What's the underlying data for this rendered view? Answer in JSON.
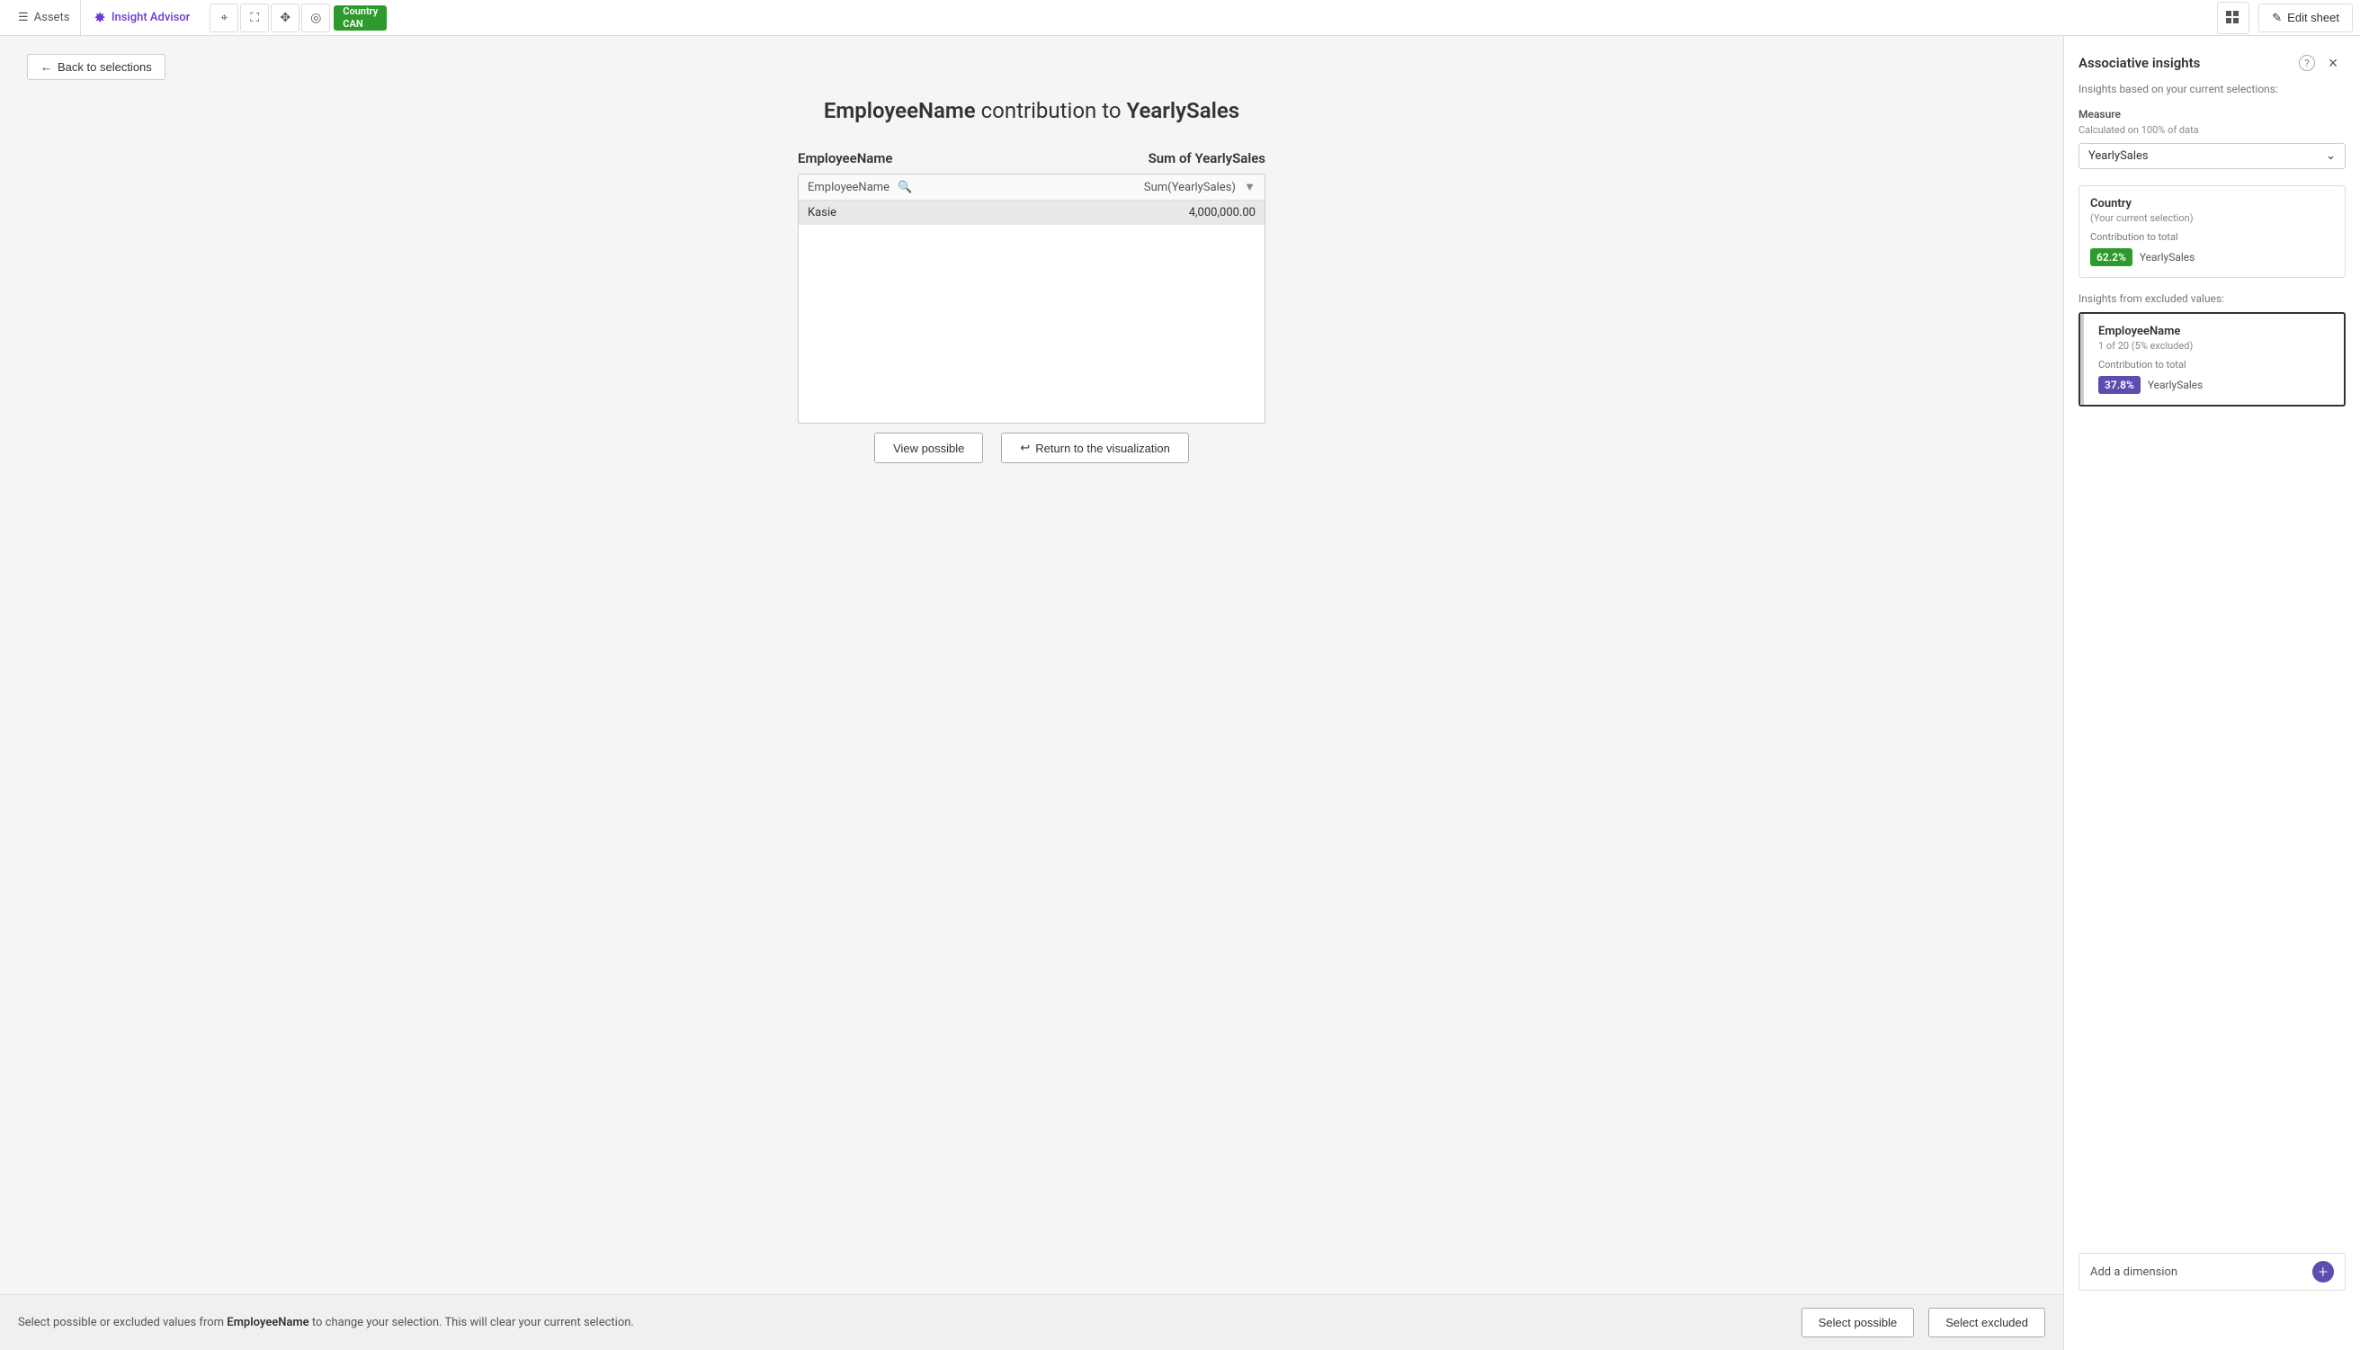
{
  "topbar": {
    "assets_label": "Assets",
    "insight_advisor_label": "Insight Advisor",
    "edit_sheet_label": "Edit sheet",
    "selection_country": "Country",
    "selection_value": "CAN"
  },
  "back_btn": "Back to selections",
  "page_title_part1": "EmployeeName",
  "page_title_middle": " contribution to ",
  "page_title_part2": "YearlySales",
  "table": {
    "col1_header": "EmployeeName",
    "col2_header": "Sum of YearlySales",
    "col1_search_placeholder": "EmployeeName",
    "col2_sort": "Sum(YearlySales)",
    "row1_name": "Kasie",
    "row1_value": "4,000,000.00"
  },
  "action_buttons": {
    "view_possible": "View possible",
    "return_label": "Return to the visualization"
  },
  "bottom_bar": {
    "text_prefix": "Select possible or excluded values from ",
    "field_name": "EmployeeName",
    "text_suffix": " to change your selection. This will clear your current selection.",
    "select_possible": "Select possible",
    "select_excluded": "Select excluded"
  },
  "sidebar": {
    "title": "Associative insights",
    "subtitle": "Insights based on your current selections:",
    "measure_section": "Measure",
    "measure_sublabel": "Calculated on 100% of data",
    "measure_value": "YearlySales",
    "current_selection_title": "Country",
    "current_selection_sub": "(Your current selection)",
    "contribution_label": "Contribution to total",
    "badge_green": "62.2%",
    "badge_green_field": "YearlySales",
    "excluded_section_label": "Insights from excluded values:",
    "excluded_card_title": "EmployeeName",
    "excluded_card_sub": "1 of 20 (5% excluded)",
    "excluded_contribution_label": "Contribution to total",
    "badge_purple": "37.8%",
    "badge_purple_field": "YearlySales",
    "add_dimension_label": "Add a dimension"
  }
}
